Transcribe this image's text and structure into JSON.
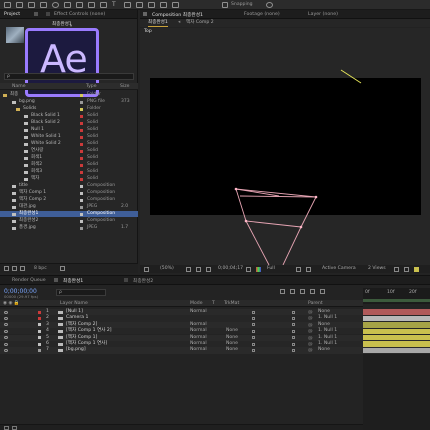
{
  "toolbar": {
    "snapping_label": "Snapping"
  },
  "project_panel": {
    "tab_project": "Project",
    "tab_effect_controls": "Effect Controls (none)",
    "selected_item": "최종완성1",
    "search_placeholder": "ρ",
    "col_name": "Name",
    "col_type": "Type",
    "col_size": "Size",
    "app_logo": "Ae",
    "items": [
      {
        "name": "최종",
        "type": "Folder",
        "size": "",
        "color": "#d4c95a"
      },
      {
        "name": "bg.png",
        "type": "PNG file",
        "size": "373",
        "color": "#999999"
      },
      {
        "name": "Solids",
        "type": "Folder",
        "size": "",
        "color": "#d4c95a"
      },
      {
        "name": "Black Solid 1",
        "type": "Solid",
        "size": "",
        "color": "#cc3a3a"
      },
      {
        "name": "Black Solid 2",
        "type": "Solid",
        "size": "",
        "color": "#cc3a3a"
      },
      {
        "name": "Null 1",
        "type": "Solid",
        "size": "",
        "color": "#cc3a3a"
      },
      {
        "name": "White Solid 1",
        "type": "Solid",
        "size": "",
        "color": "#cc3a3a"
      },
      {
        "name": "White Solid 2",
        "type": "Solid",
        "size": "",
        "color": "#cc3a3a"
      },
      {
        "name": "연사랑",
        "type": "Solid",
        "size": "",
        "color": "#cc3a3a"
      },
      {
        "name": "회색1",
        "type": "Solid",
        "size": "",
        "color": "#cc3a3a"
      },
      {
        "name": "회색2",
        "type": "Solid",
        "size": "",
        "color": "#cc3a3a"
      },
      {
        "name": "회색3",
        "type": "Solid",
        "size": "",
        "color": "#cc3a3a"
      },
      {
        "name": "액자",
        "type": "Solid",
        "size": "",
        "color": "#cc3a3a"
      },
      {
        "name": "title",
        "type": "Composition",
        "size": "",
        "color": "#c0c0c0"
      },
      {
        "name": "액자 Comp 1",
        "type": "Composition",
        "size": "",
        "color": "#c0c0c0"
      },
      {
        "name": "액자 Comp 2",
        "type": "Composition",
        "size": "",
        "color": "#c0c0c0"
      },
      {
        "name": "대관.jpg",
        "type": "JPEG",
        "size": "2.0",
        "color": "#999999"
      },
      {
        "name": "최종완성1",
        "type": "Composition",
        "size": "",
        "color": "#c0c0c0",
        "selected": true
      },
      {
        "name": "최종완성2",
        "type": "Composition",
        "size": "",
        "color": "#c0c0c0"
      },
      {
        "name": "풍경.jpg",
        "type": "JPEG",
        "size": "1.7",
        "color": "#999999"
      }
    ],
    "footer_bpc": "8 bpc"
  },
  "comp_panel": {
    "tab_composition": "Composition 최종완성1",
    "tab_footage": "Footage (none)",
    "tab_layer": "Layer (none)",
    "sub_tab_1": "최종완성1",
    "sub_tab_2": "액자 Comp 2",
    "view_label": "Top",
    "zoom": "(50%)",
    "timecode": "0;00;04;17",
    "resolution": "Full",
    "camera": "Active Camera",
    "views": "2 Views"
  },
  "timeline": {
    "render_queue_tab": "Render Queue",
    "comp_tab_1": "최종완성1",
    "comp_tab_2": "최종완성2",
    "current_time": "0;00;00;00",
    "fps_text": "00000 (29.97 fps)",
    "search_placeholder": "ρ",
    "col_layer_name": "Layer Name",
    "col_mode": "Mode",
    "col_t": "T",
    "col_trkmat": "TrkMat",
    "col_parent": "Parent",
    "ruler_labels": [
      "0f",
      "10f",
      "20f"
    ],
    "layers": [
      {
        "num": "1",
        "name": "[Null 1]",
        "mode": "Normal",
        "trkmat": "",
        "parent": "None",
        "color": "#cc3a3a",
        "bar": "#b05a5a"
      },
      {
        "num": "2",
        "name": "Camera 1",
        "mode": "",
        "trkmat": "",
        "parent": "1. Null 1",
        "color": "#cc3a3a",
        "bar": "#b8b8b8"
      },
      {
        "num": "3",
        "name": "[액자 Comp 2]",
        "mode": "Normal",
        "trkmat": "",
        "parent": "None",
        "color": "#c0c0c0",
        "bar": "#a6a346"
      },
      {
        "num": "4",
        "name": "[액자 Comp 1 연사 2]",
        "mode": "Normal",
        "trkmat": "None",
        "parent": "1. Null 1",
        "color": "#c0c0c0",
        "bar": "#c9c04e"
      },
      {
        "num": "5",
        "name": "[액자 Comp 1]",
        "mode": "Normal",
        "trkmat": "None",
        "parent": "1. Null 1",
        "color": "#c0c0c0",
        "bar": "#c9c04e"
      },
      {
        "num": "6",
        "name": "[액자 Comp 1 연사]",
        "mode": "Normal",
        "trkmat": "None",
        "parent": "1. Null 1",
        "color": "#c0c0c0",
        "bar": "#c9c04e"
      },
      {
        "num": "7",
        "name": "[bg.png]",
        "mode": "Normal",
        "trkmat": "None",
        "parent": "None",
        "color": "#999999",
        "bar": "#a8a8a8"
      }
    ]
  }
}
